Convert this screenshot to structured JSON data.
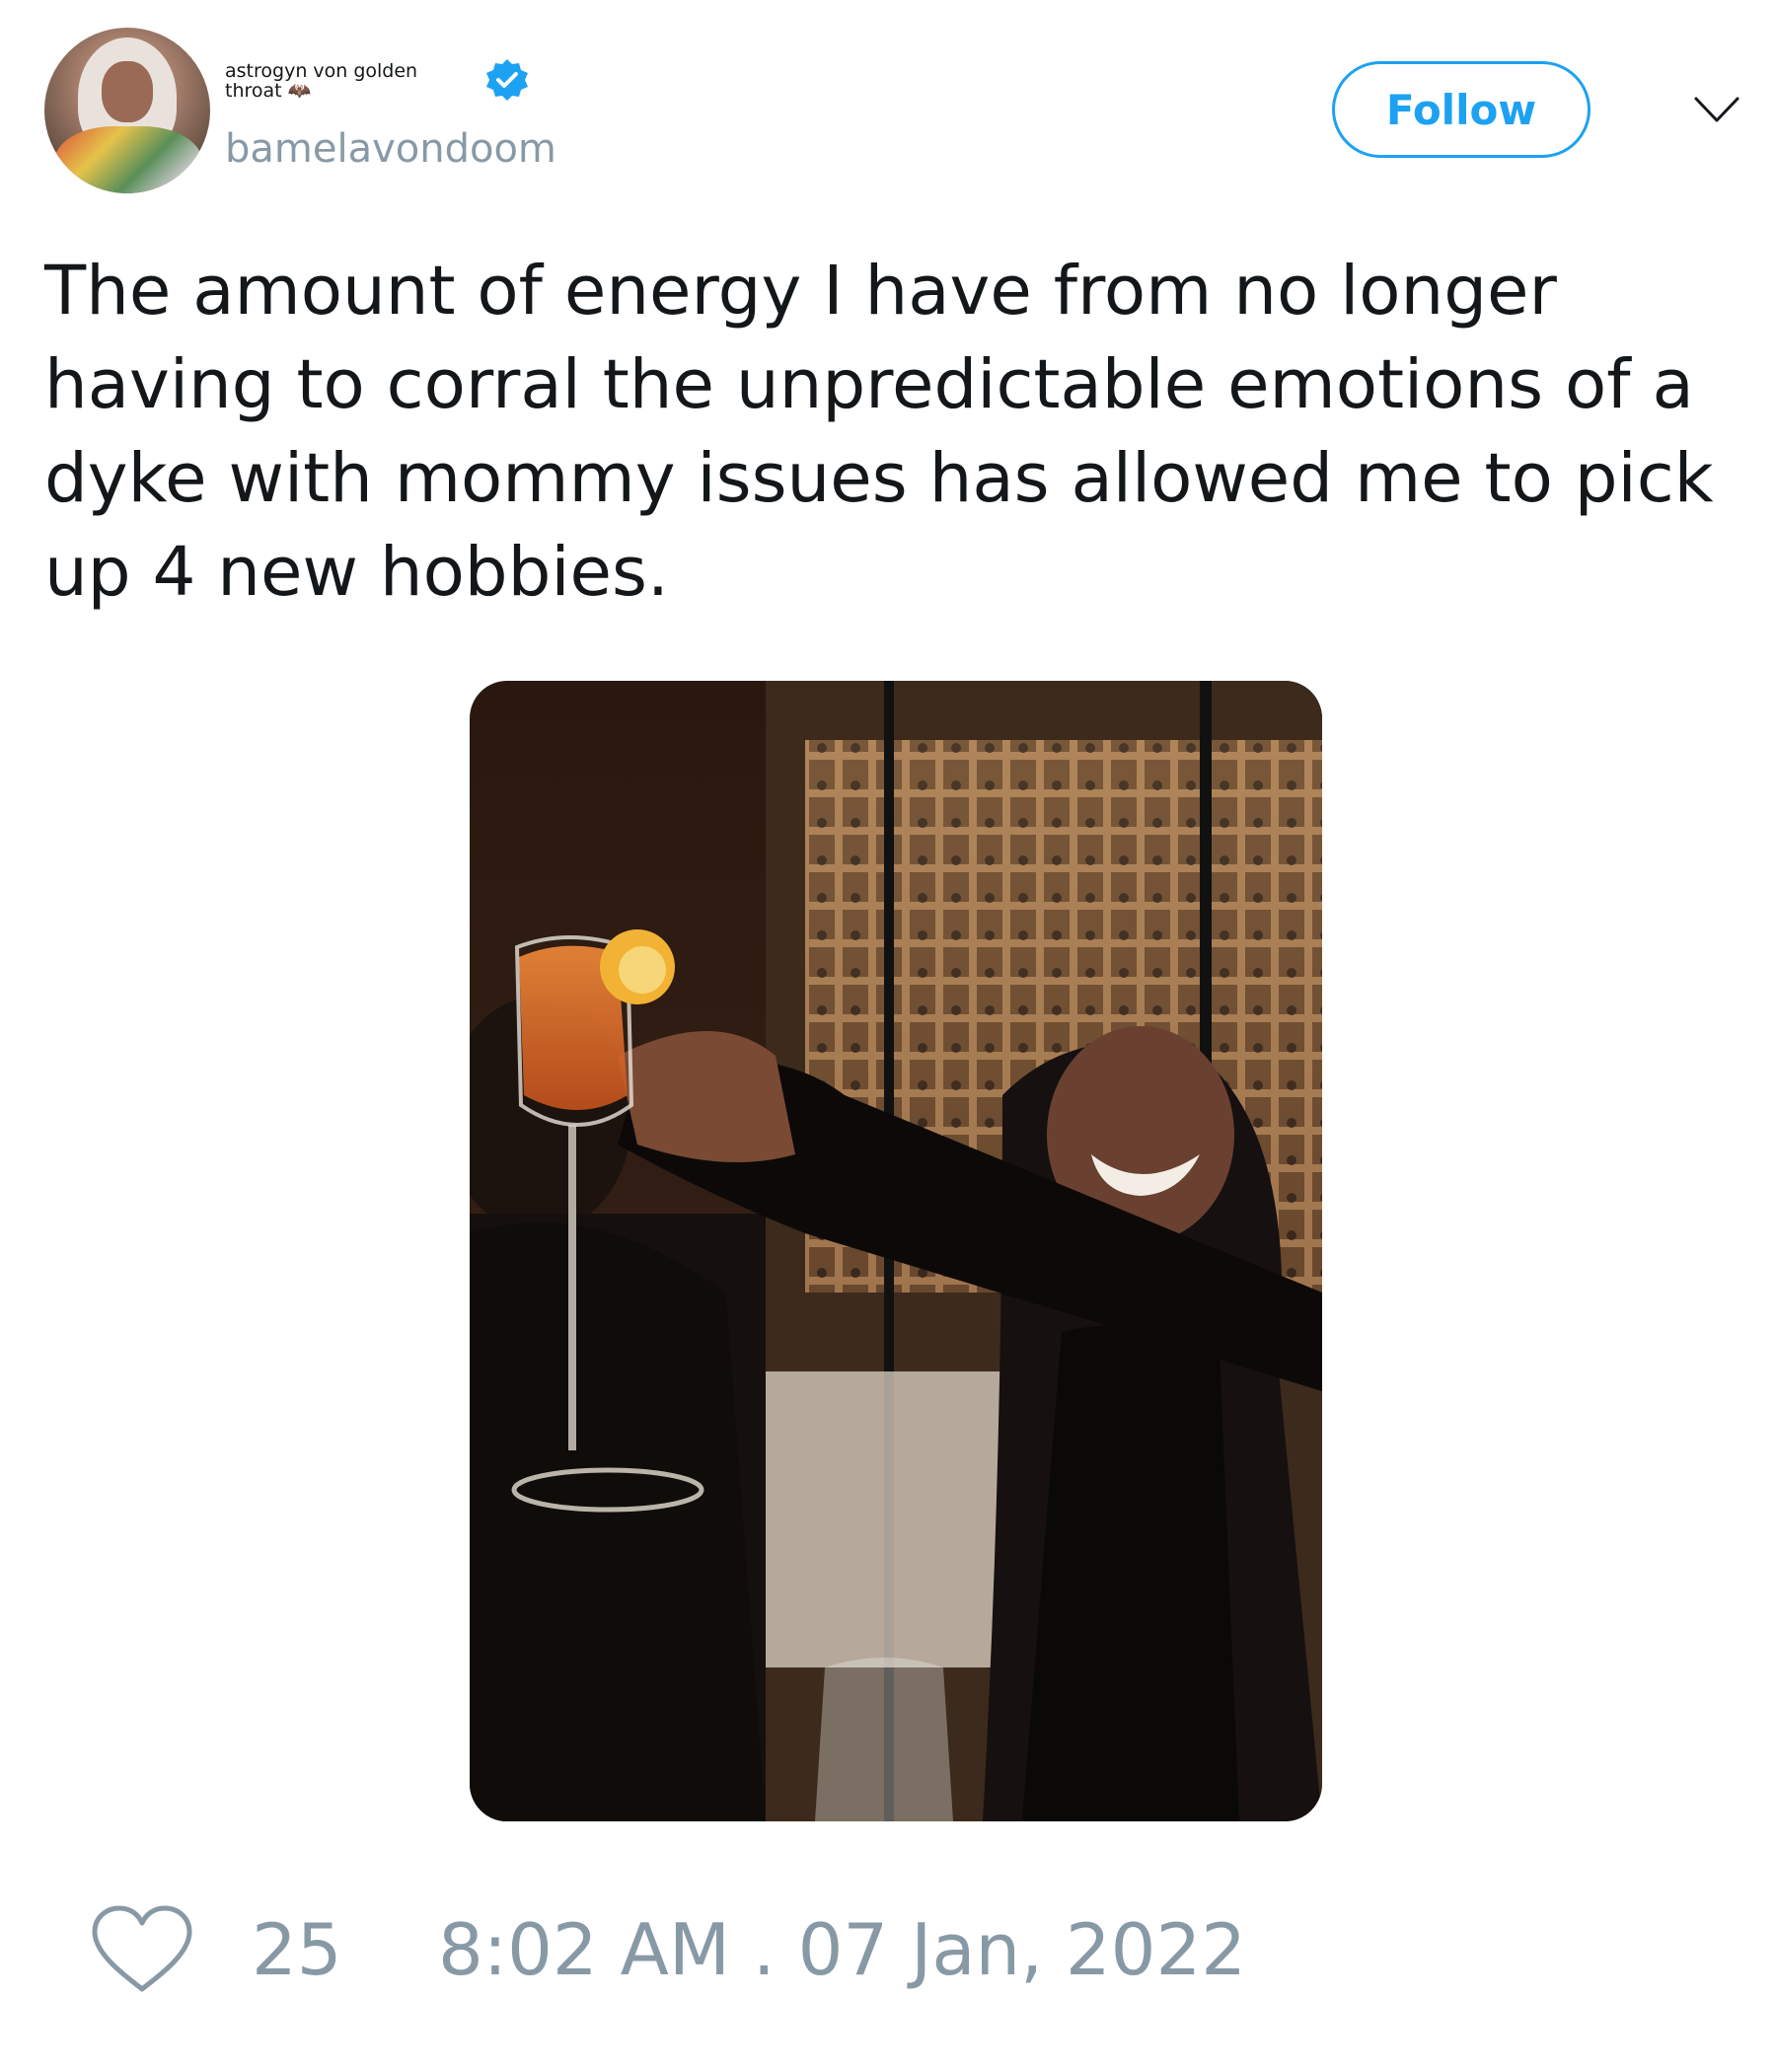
{
  "tweet": {
    "author": {
      "display_name": "astrogyn von golden throat 🦇",
      "handle": "bamelavondoom",
      "verified": true,
      "verified_icon": "verified-badge-icon"
    },
    "follow_label": "Follow",
    "more_icon": "chevron-down-icon",
    "text": "The amount of energy I have from no longer having to corral the unpredictable emotions of a dyke with mommy issues has allowed me to pick up 4 new hobbies.",
    "like_icon": "heart-icon",
    "like_count": "25",
    "timestamp": "8:02 AM . 07 Jan, 2022"
  },
  "colors": {
    "accent": "#1da1f2",
    "muted": "#8899a6",
    "text": "#14171a"
  }
}
